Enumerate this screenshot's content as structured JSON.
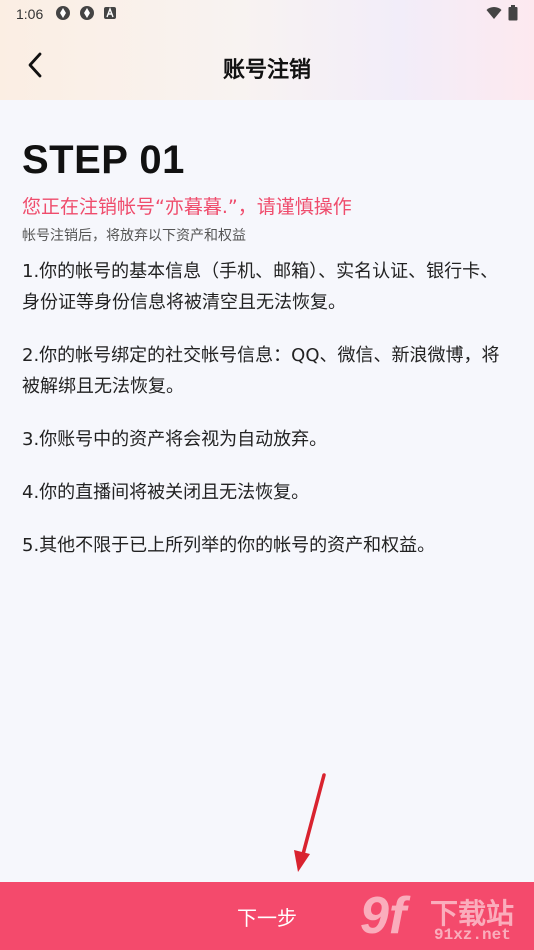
{
  "status_bar": {
    "time": "1:06",
    "notif_icons": [
      "sync-icon",
      "sync-icon",
      "font-a-icon"
    ],
    "right_icons": [
      "wifi-icon",
      "battery-icon"
    ]
  },
  "nav": {
    "title": "账号注销",
    "back_icon": "chevron-left-icon"
  },
  "main": {
    "step_title": "STEP 01",
    "warning": "您正在注销帐号“亦暮暮.”，请谨慎操作",
    "note": "帐号注销后，将放弃以下资产和权益",
    "items": [
      "1.你的帐号的基本信息（手机、邮箱）、实名认证、银行卡、身份证等身份信息将被清空且无法恢复。",
      "2.你的帐号绑定的社交帐号信息：QQ、微信、新浪微博，将被解绑且无法恢复。",
      "3.你账号中的资产将会视为自动放弃。",
      "4.你的直播间将被关闭且无法恢复。",
      "5.其他不限于已上所列举的你的帐号的资产和权益。"
    ]
  },
  "footer": {
    "next_label": "下一步"
  },
  "watermark": {
    "logo": "9f",
    "text": "下载站",
    "url": "91xz.net"
  },
  "colors": {
    "accent": "#f44a6c",
    "warning_text": "#ef4c6c"
  }
}
